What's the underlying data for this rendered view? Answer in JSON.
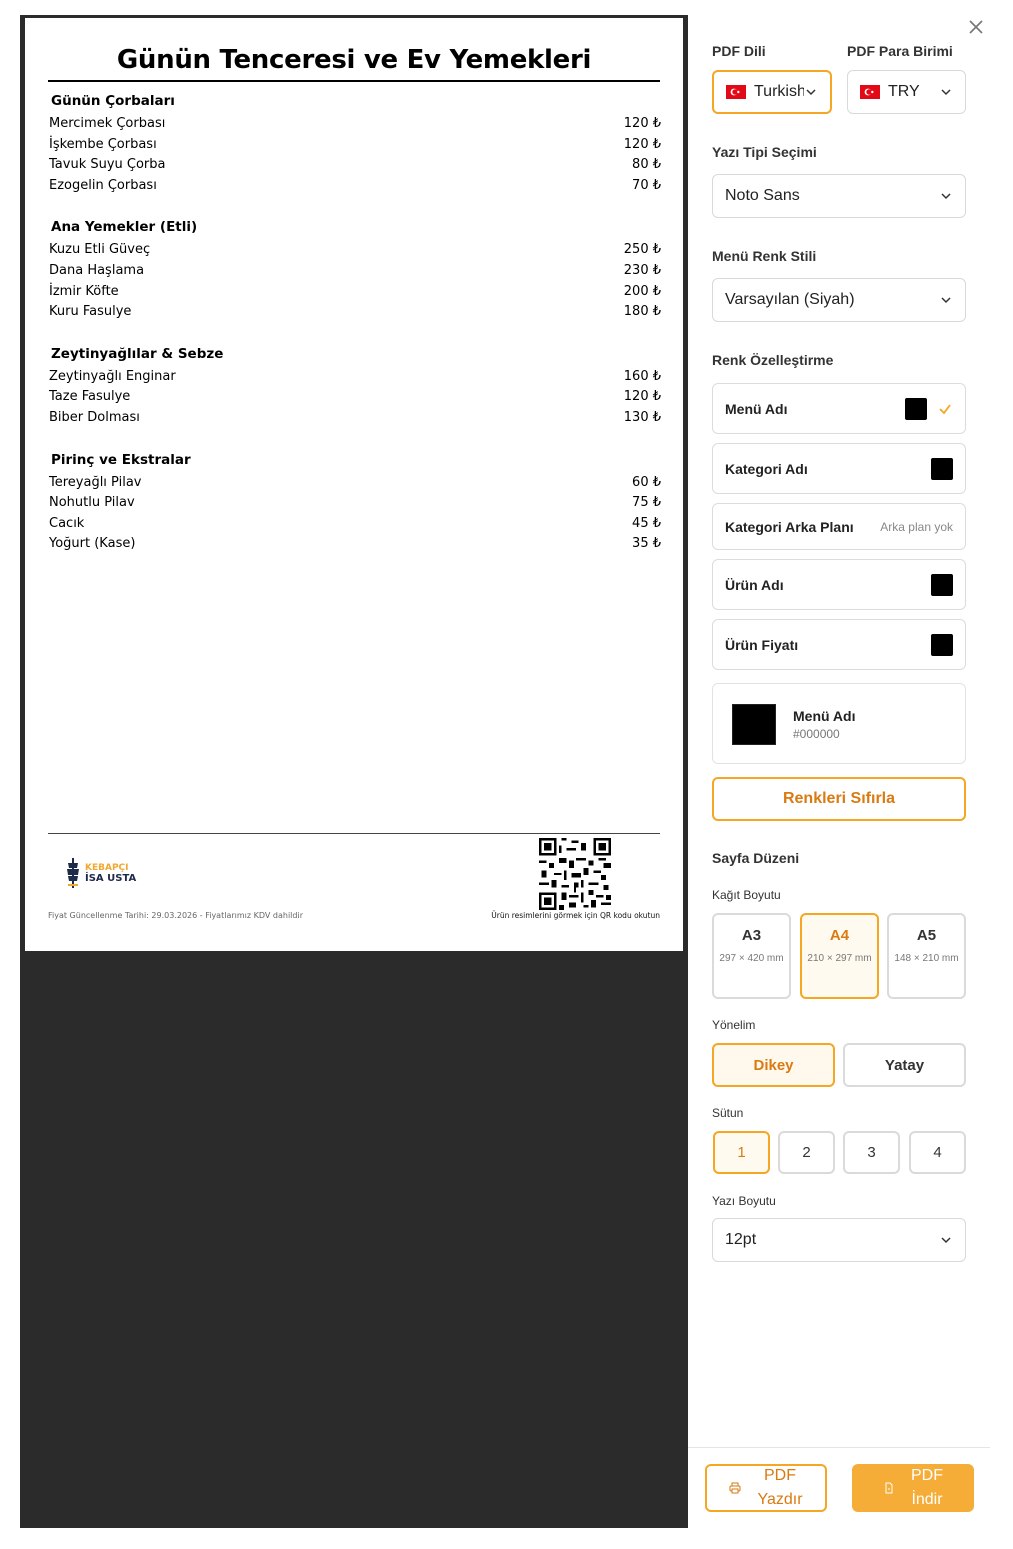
{
  "menu": {
    "title": "Günün Tenceresi ve Ev Yemekleri",
    "categories": [
      {
        "name": "Günün Çorbaları",
        "items": [
          {
            "name": "Mercimek Çorbası",
            "price": "120 ₺"
          },
          {
            "name": "İşkembe Çorbası",
            "price": "120 ₺"
          },
          {
            "name": "Tavuk Suyu Çorba",
            "price": "80 ₺"
          },
          {
            "name": "Ezogelin Çorbası",
            "price": "70 ₺"
          }
        ]
      },
      {
        "name": "Ana Yemekler (Etli)",
        "items": [
          {
            "name": "Kuzu Etli Güveç",
            "price": "250 ₺"
          },
          {
            "name": "Dana Haşlama",
            "price": "230 ₺"
          },
          {
            "name": "İzmir Köfte",
            "price": "200 ₺"
          },
          {
            "name": "Kuru Fasulye",
            "price": "180 ₺"
          }
        ]
      },
      {
        "name": "Zeytinyağlılar & Sebze",
        "items": [
          {
            "name": "Zeytinyağlı Enginar",
            "price": "160 ₺"
          },
          {
            "name": "Taze Fasulye",
            "price": "120 ₺"
          },
          {
            "name": "Biber Dolması",
            "price": "130 ₺"
          }
        ]
      },
      {
        "name": "Pirinç ve Ekstralar",
        "items": [
          {
            "name": "Tereyağlı Pilav",
            "price": "60 ₺"
          },
          {
            "name": "Nohutlu Pilav",
            "price": "75 ₺"
          },
          {
            "name": "Cacık",
            "price": "45 ₺"
          },
          {
            "name": "Yoğurt (Kase)",
            "price": "35 ₺"
          }
        ]
      }
    ],
    "logo": {
      "line1": "KEBAPÇI",
      "line2": "İSA USTA"
    },
    "footer_left": "Fiyat Güncellenme Tarihi: 29.03.2026 - Fiyatlarımız KDV dahildir",
    "footer_right": "Ürün resimlerini görmek için QR kodu okutun"
  },
  "panel": {
    "pdf_lang_label": "PDF Dili",
    "pdf_lang_value": "Turkish",
    "pdf_currency_label": "PDF Para Birimi",
    "pdf_currency_value": "TRY",
    "font_label": "Yazı Tipi Seçimi",
    "font_value": "Noto Sans",
    "color_style_label": "Menü Renk Stili",
    "color_style_value": "Varsayılan (Siyah)",
    "color_custom_label": "Renk Özelleştirme",
    "color_rows": [
      {
        "name": "Menü Adı",
        "color": "#000000",
        "selected": true
      },
      {
        "name": "Kategori Adı",
        "color": "#000000"
      },
      {
        "name": "Kategori Arka Planı",
        "note": "Arka plan yok"
      },
      {
        "name": "Ürün Adı",
        "color": "#000000"
      },
      {
        "name": "Ürün Fiyatı",
        "color": "#000000"
      }
    ],
    "preview_name": "Menü Adı",
    "preview_hex": "#000000",
    "reset_label": "Renkleri Sıfırla",
    "layout_label": "Sayfa Düzeni",
    "paper_label": "Kağıt Boyutu",
    "papers": [
      {
        "name": "A3",
        "dims": "297 × 420 mm"
      },
      {
        "name": "A4",
        "dims": "210 × 297 mm",
        "selected": true
      },
      {
        "name": "A5",
        "dims": "148 × 210 mm"
      }
    ],
    "orientation_label": "Yönelim",
    "orientations": [
      "Dikey",
      "Yatay"
    ],
    "orientation_selected": "Dikey",
    "columns_label": "Sütun",
    "columns": [
      "1",
      "2",
      "3",
      "4"
    ],
    "columns_selected": "1",
    "font_size_label": "Yazı Boyutu",
    "font_size_value": "12pt",
    "print_label_1": "PDF",
    "print_label_2": "Yazdır",
    "download_label_1": "PDF",
    "download_label_2": "İndir",
    "accent_color": "#f5a623"
  }
}
